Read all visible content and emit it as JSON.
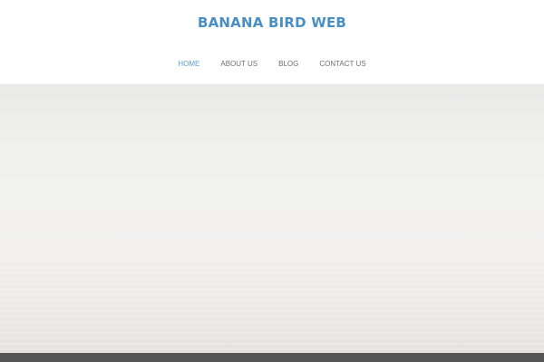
{
  "site": {
    "title": "BANANA BIRD WEB"
  },
  "nav": {
    "items": [
      {
        "label": "HOME",
        "active": true
      },
      {
        "label": "ABOUT US",
        "active": false
      },
      {
        "label": "BLOG",
        "active": false
      },
      {
        "label": "CONTACT US",
        "active": false
      }
    ]
  },
  "colors": {
    "title": "#4a8fc4",
    "nav_active": "#5b9bd5",
    "nav_default": "#707070",
    "footer": "#555555"
  }
}
